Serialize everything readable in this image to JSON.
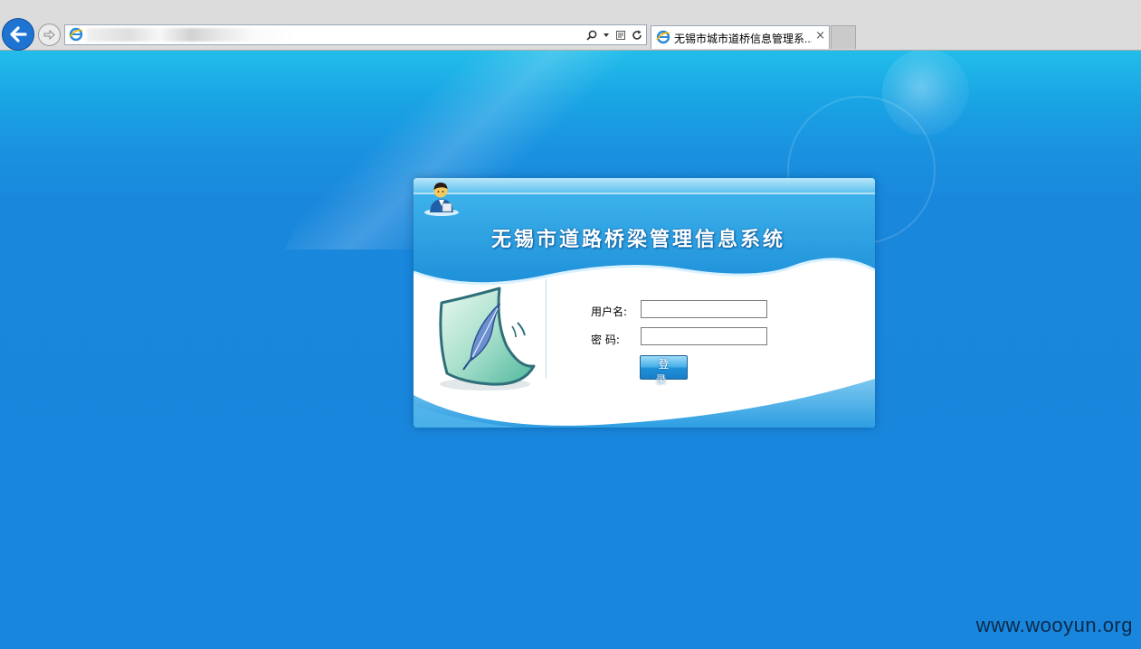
{
  "browser": {
    "address_url": "",
    "tab_title": "无锡市城市道桥信息管理系...",
    "tab_close": "×",
    "accent_color": "#1f74d2"
  },
  "page": {
    "system_title": "无锡市道路桥梁管理信息系统",
    "form": {
      "username_label": "用户名:",
      "password_label": "密 码:",
      "username_value": "",
      "password_value": "",
      "login_button": "登 录"
    },
    "watermark": "www.wooyun.org",
    "colors": {
      "background": "#1886dc",
      "panel_header": "#2aa3e4",
      "button": "#1d8fd8"
    }
  }
}
